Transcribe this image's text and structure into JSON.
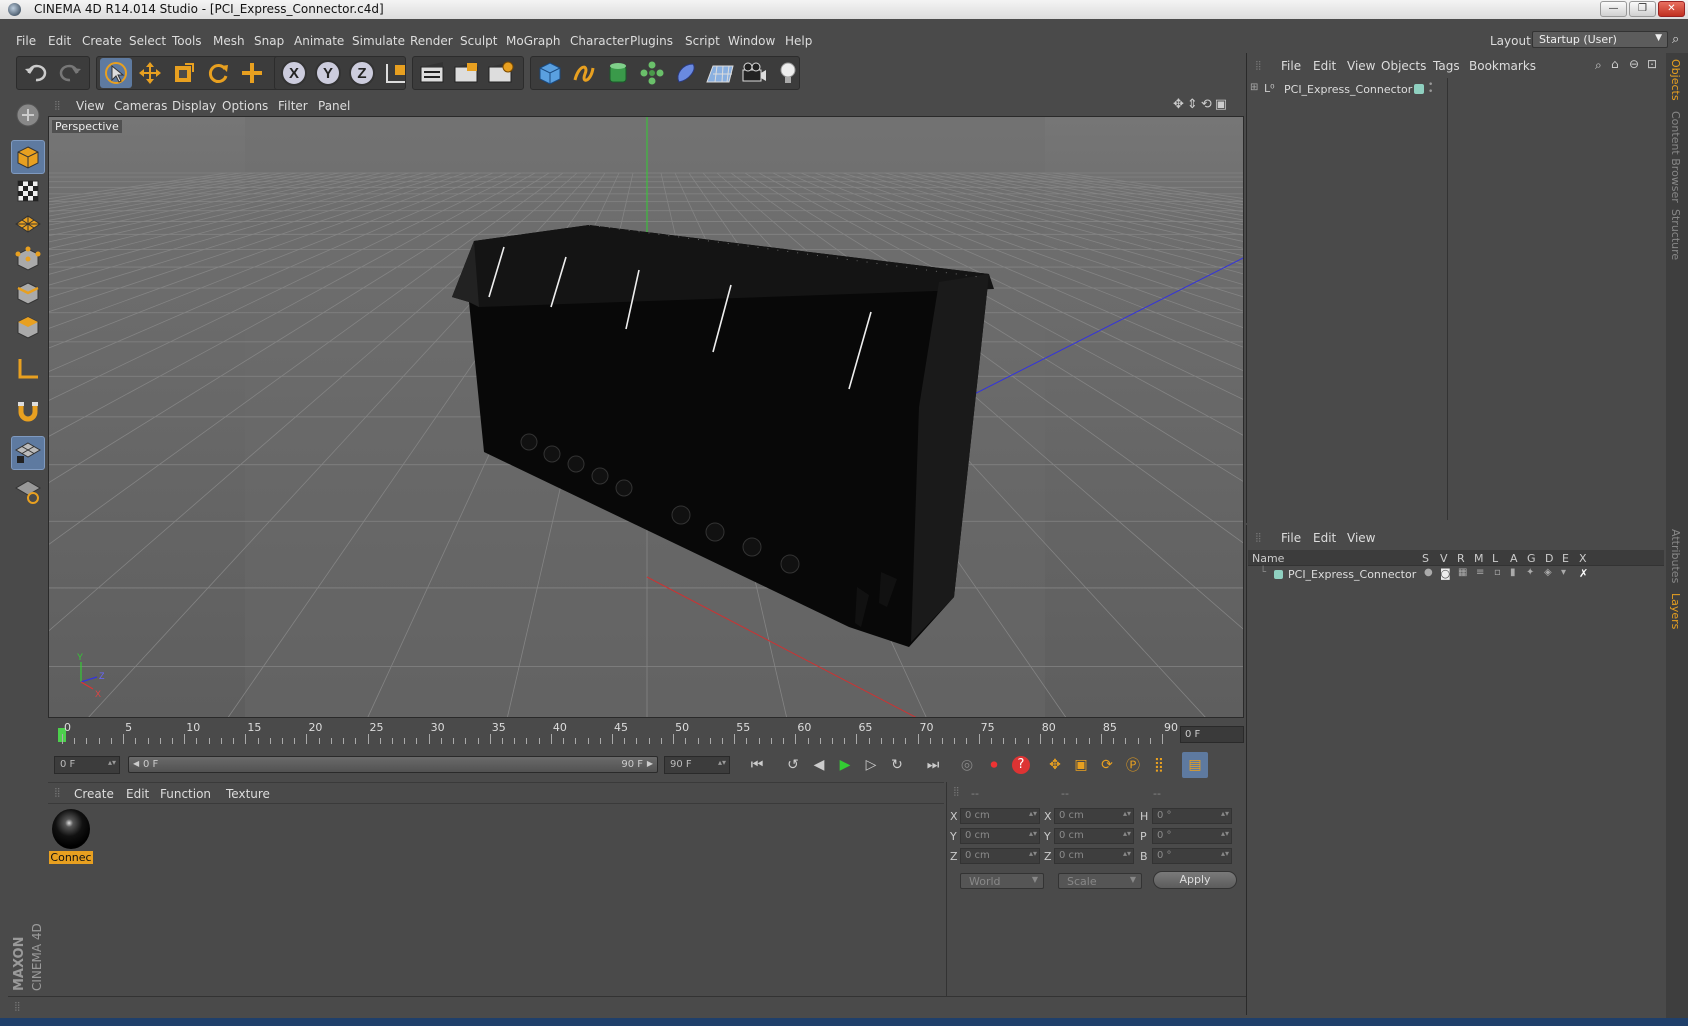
{
  "window": {
    "title": "CINEMA 4D R14.014 Studio - [PCI_Express_Connector.c4d]",
    "minimize": "—",
    "restore": "❐",
    "close": "✕"
  },
  "menubar": {
    "items": [
      "File",
      "Edit",
      "Create",
      "Select",
      "Tools",
      "Mesh",
      "Snap",
      "Animate",
      "Simulate",
      "Render",
      "Sculpt",
      "MoGraph",
      "Character",
      "Plugins",
      "Script",
      "Window",
      "Help"
    ],
    "layout_label": "Layout:",
    "layout_value": "Startup (User)"
  },
  "toolbar": {
    "icons": [
      "undo-icon",
      "redo-icon",
      "live-selection-icon",
      "move-icon",
      "scale-icon",
      "rotate-icon",
      "add-object-icon",
      "x-axis-icon",
      "y-axis-icon",
      "z-axis-icon",
      "world-coordinates-icon",
      "render-view-icon",
      "render-picture-viewer-icon",
      "edit-render-settings-icon",
      "cube-primitive-icon",
      "spline-pen-icon",
      "nurbs-icon",
      "array-icon",
      "deformer-icon",
      "floor-icon",
      "camera-icon",
      "light-icon"
    ],
    "axis_labels": [
      "X",
      "Y",
      "Z"
    ]
  },
  "viewport": {
    "menu": [
      "View",
      "Cameras",
      "Display",
      "Options",
      "Filter",
      "Panel"
    ],
    "label": "Perspective",
    "axis_labels": {
      "y": "Y",
      "z": "Z",
      "x": "X"
    }
  },
  "timeline": {
    "ticks": [
      "0",
      "5",
      "10",
      "15",
      "20",
      "25",
      "30",
      "35",
      "40",
      "45",
      "50",
      "55",
      "60",
      "65",
      "70",
      "75",
      "80",
      "85",
      "90"
    ],
    "current_frame": "0 F",
    "start_field": "0 F",
    "slider_start": "0 F",
    "slider_end": "90 F",
    "end_field": "90 F"
  },
  "materials": {
    "menu": [
      "Create",
      "Edit",
      "Function",
      "Texture"
    ],
    "items": [
      {
        "name": "Connec"
      }
    ]
  },
  "coordinates": {
    "headers": [
      "--",
      "--",
      "--"
    ],
    "rows": [
      {
        "l1": "X",
        "v1": "0 cm",
        "l2": "X",
        "v2": "0 cm",
        "l3": "H",
        "v3": "0 °"
      },
      {
        "l1": "Y",
        "v1": "0 cm",
        "l2": "Y",
        "v2": "0 cm",
        "l3": "P",
        "v3": "0 °"
      },
      {
        "l1": "Z",
        "v1": "0 cm",
        "l2": "Z",
        "v2": "0 cm",
        "l3": "B",
        "v3": "0 °"
      }
    ],
    "mode1": "World",
    "mode2": "Scale",
    "apply": "Apply"
  },
  "objects_panel": {
    "menu": [
      "File",
      "Edit",
      "View",
      "Objects",
      "Tags",
      "Bookmarks"
    ],
    "items": [
      {
        "name": "PCI_Express_Connector"
      }
    ]
  },
  "layers_panel": {
    "menu": [
      "File",
      "Edit",
      "View"
    ],
    "columns": [
      "Name",
      "S",
      "V",
      "R",
      "M",
      "L",
      "A",
      "G",
      "D",
      "E",
      "X"
    ],
    "items": [
      {
        "name": "PCI_Express_Connector"
      }
    ]
  },
  "right_tabs": [
    "Objects",
    "Content Browser",
    "Structure",
    "Attributes",
    "Layers"
  ],
  "logo": {
    "brand": "MAXON",
    "product": "CINEMA 4D"
  },
  "colors": {
    "accent": "#e8a020",
    "active": "#5e7aa0",
    "background": "#4a4a4a",
    "viewport": "#6a6a6a"
  }
}
